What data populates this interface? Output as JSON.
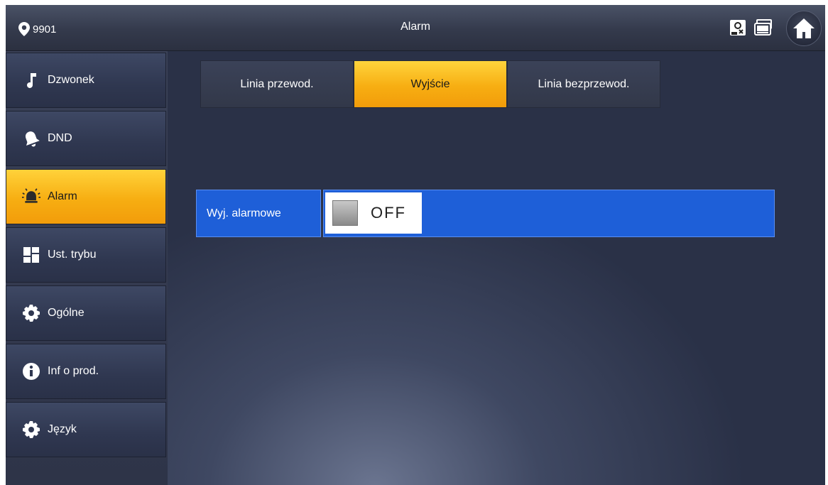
{
  "header": {
    "location_label": "9901",
    "title": "Alarm",
    "icons": [
      "location-pin-icon",
      "camera-monitor-icon",
      "device-icon",
      "home-icon"
    ]
  },
  "sidebar": {
    "items": [
      {
        "label": "Dzwonek",
        "icon": "music-note-icon",
        "active": false
      },
      {
        "label": "DND",
        "icon": "bell-icon",
        "active": false
      },
      {
        "label": "Alarm",
        "icon": "alarm-icon",
        "active": true
      },
      {
        "label": "Ust. trybu",
        "icon": "mode-grid-icon",
        "active": false
      },
      {
        "label": "Ogólne",
        "icon": "gear-icon",
        "active": false
      },
      {
        "label": "Inf o prod.",
        "icon": "info-icon",
        "active": false
      },
      {
        "label": "Język",
        "icon": "gear-icon",
        "active": false
      }
    ]
  },
  "tabs": [
    {
      "label": "Linia przewod.",
      "active": false
    },
    {
      "label": "Wyjście",
      "active": true
    },
    {
      "label": "Linia bezprzewod.",
      "active": false
    }
  ],
  "settings": {
    "alarm_output": {
      "label": "Wyj. alarmowe",
      "value": "OFF"
    }
  },
  "colors": {
    "accent": "#f7ae12",
    "highlight_blue": "#1e5fd8",
    "sidebar_bg": "#2f3750"
  }
}
